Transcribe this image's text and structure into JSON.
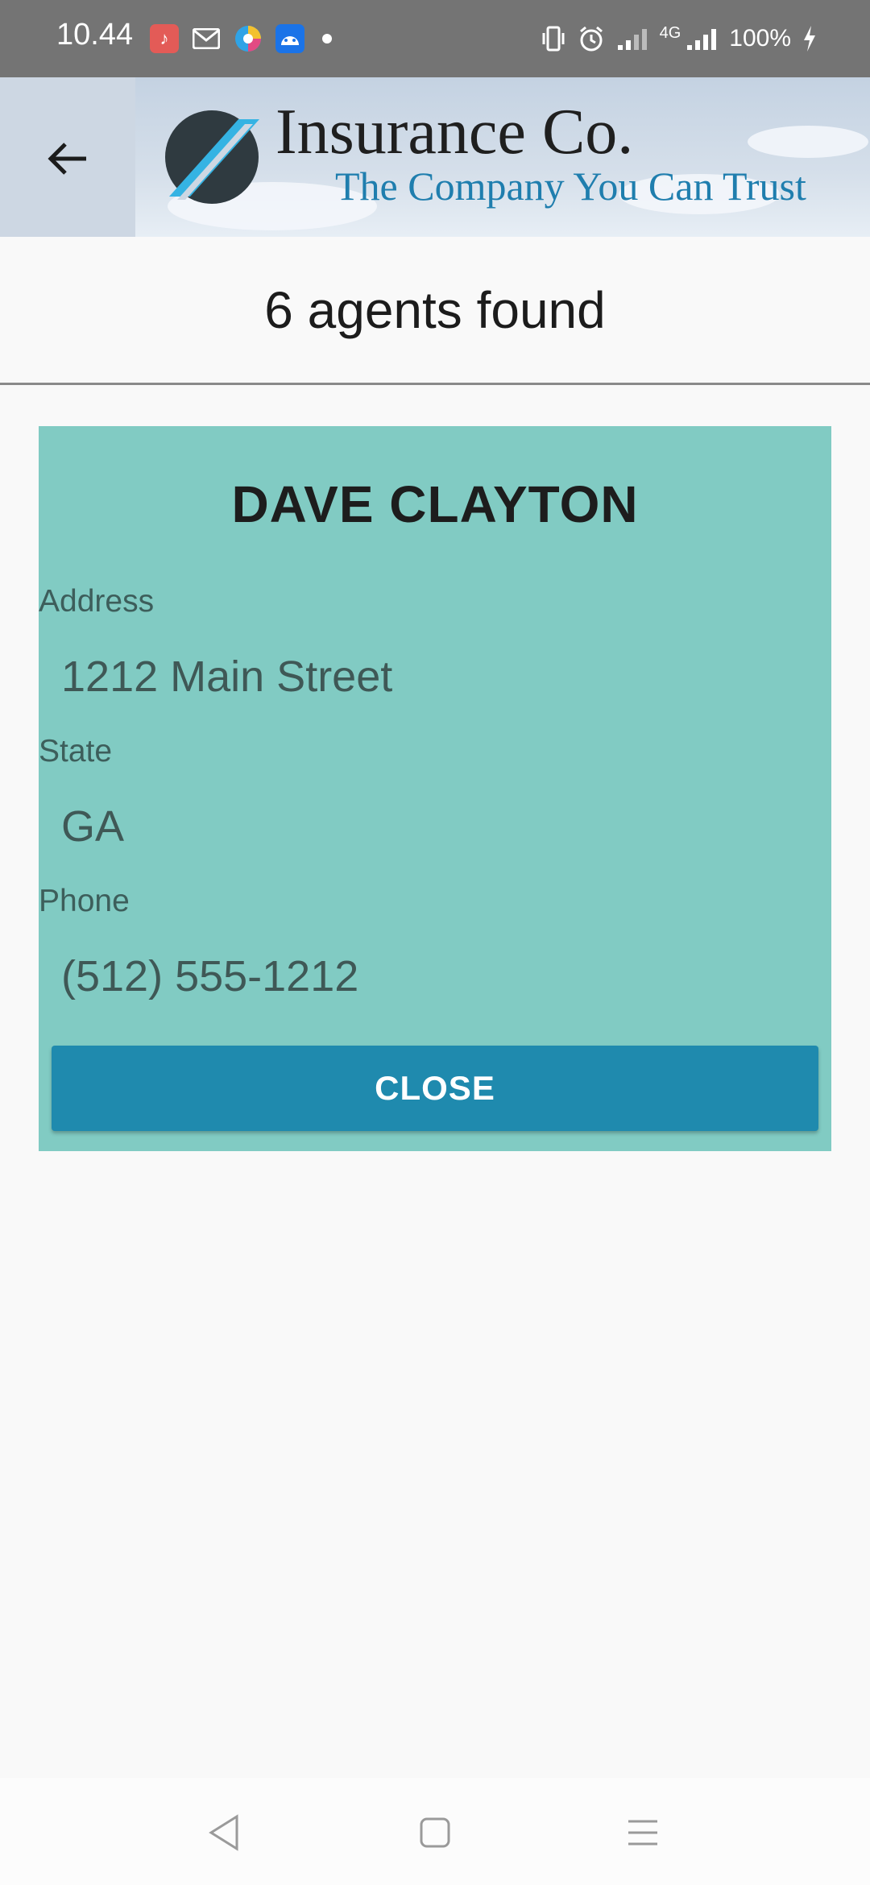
{
  "status_bar": {
    "time": "10.44",
    "battery": "100%",
    "network": "4G",
    "apps": [
      "music-app-icon",
      "gmail-icon",
      "browser-icon",
      "android-robot-icon"
    ]
  },
  "header": {
    "brand_title": "Insurance Co.",
    "brand_tagline": "The Company You Can Trust",
    "colors": {
      "title": "#1f1f1f",
      "tagline": "#1f7eae"
    }
  },
  "results": {
    "text": "6 agents found"
  },
  "agent": {
    "name": "DAVE CLAYTON",
    "address_label": "Address",
    "address_value": "1212 Main Street",
    "state_label": "State",
    "state_value": "GA",
    "phone_label": "Phone",
    "phone_value": "(512) 555-1212",
    "close_label": "CLOSE",
    "colors": {
      "card_bg": "#81cbc3",
      "button_bg": "#1f8aae"
    }
  }
}
